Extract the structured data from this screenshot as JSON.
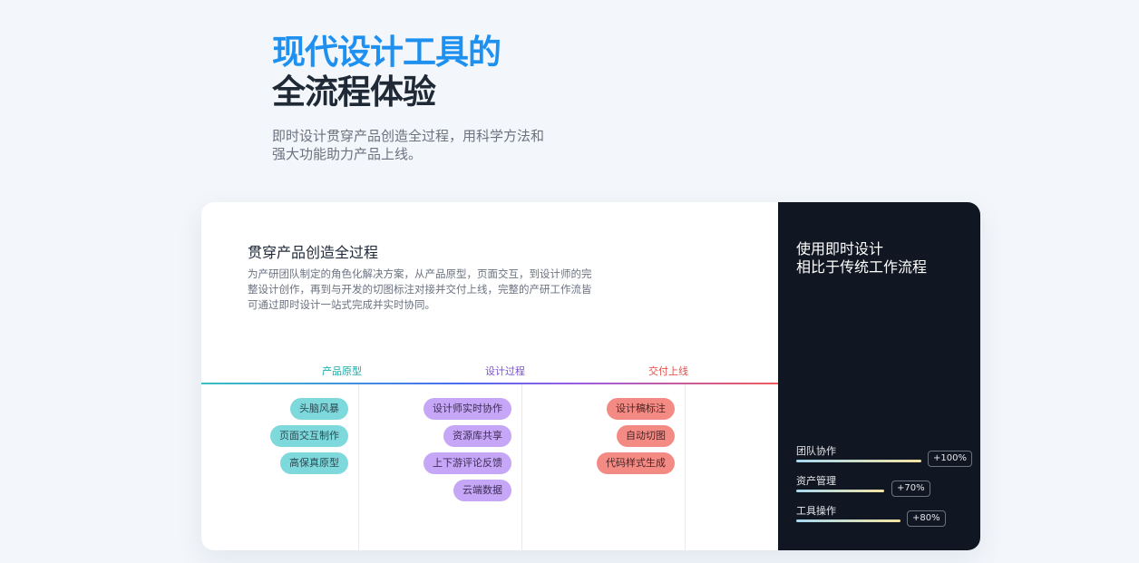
{
  "hero": {
    "title_line1": "现代设计工具的",
    "title_line2": "全流程体验",
    "subtitle": "即时设计贯穿产品创造全过程，用科学方法和强大功能助力产品上线。"
  },
  "process": {
    "title": "贯穿产品创造全过程",
    "description": "为产研团队制定的角色化解决方案，从产品原型，页面交互，到设计师的完整设计创作，再到与开发的切图标注对接并交付上线，完整的产研工作流皆可通过即时设计一站式完成并实时协同。",
    "stages": [
      {
        "label": "产品原型",
        "color": "#1aa9a6",
        "items": [
          "头脑风暴",
          "页面交互制作",
          "高保真原型"
        ]
      },
      {
        "label": "设计过程",
        "color": "#7c4fd6",
        "items": [
          "设计师实时协作",
          "资源库共享",
          "上下游评论反馈",
          "云端数据"
        ]
      },
      {
        "label": "交付上线",
        "color": "#e0524e",
        "items": [
          "设计稿标注",
          "自动切图",
          "代码样式生成"
        ]
      }
    ]
  },
  "comparison": {
    "title_line1": "使用即时设计",
    "title_line2": "相比于传统工作流程",
    "metrics": [
      {
        "label": "团队协作",
        "value": "+100%",
        "percent": 100
      },
      {
        "label": "资产管理",
        "value": "+70%",
        "percent": 70
      },
      {
        "label": "工具操作",
        "value": "+80%",
        "percent": 80
      }
    ]
  }
}
